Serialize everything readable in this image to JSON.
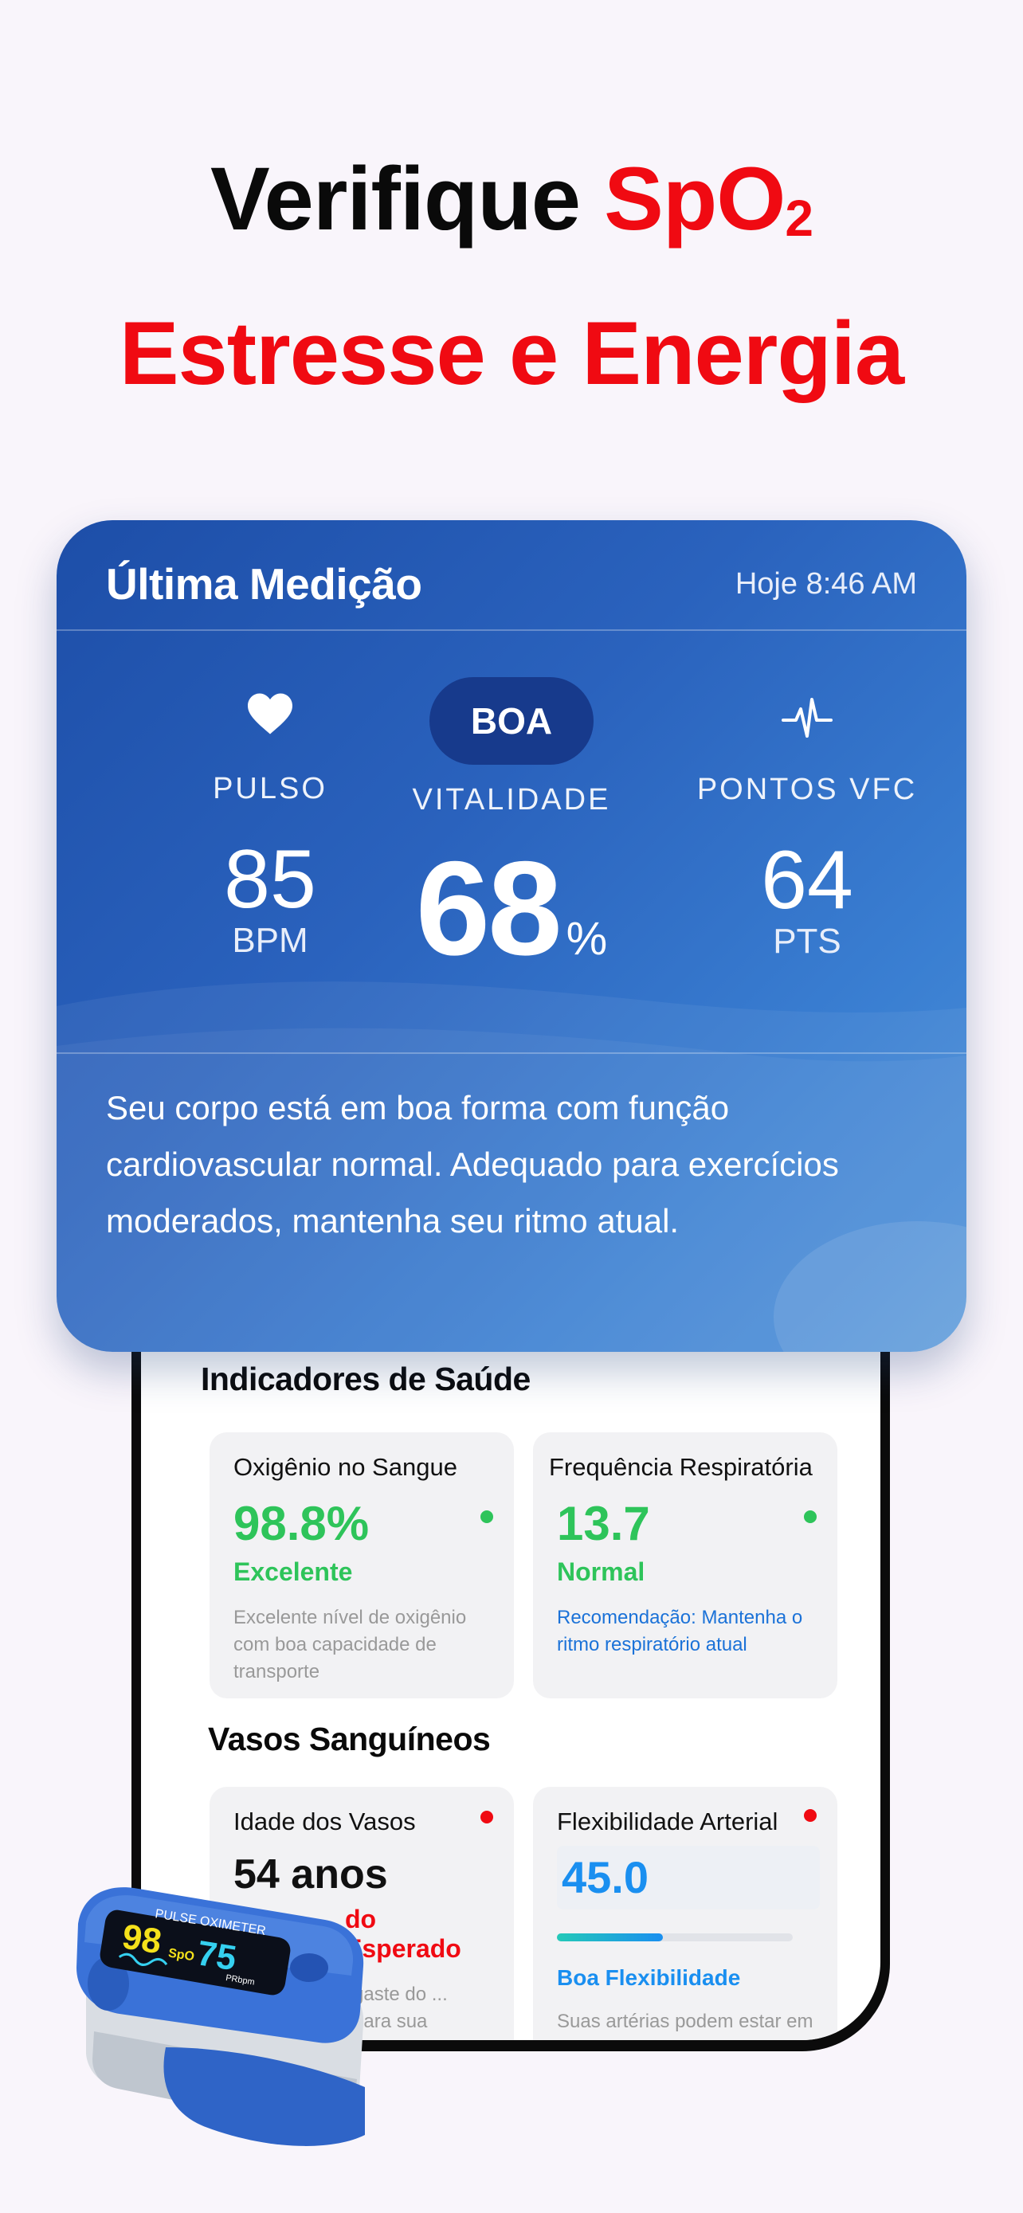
{
  "headline": {
    "line1_black": "Verifique",
    "line1_red": "SpO",
    "line1_sub": "2",
    "line2": "Estresse e Energia"
  },
  "card": {
    "title": "Última Medição",
    "time": "Hoje 8:46 AM",
    "pulse": {
      "label": "PULSO",
      "value": "85",
      "unit": "BPM",
      "icon": "heart-icon"
    },
    "vitality": {
      "badge": "BOA",
      "label": "VITALIDADE",
      "value": "68",
      "unit": "%"
    },
    "hrv": {
      "label": "PONTOS VFC",
      "value": "64",
      "unit": "PTS",
      "icon": "pulse-wave-icon"
    },
    "description": "Seu corpo está em boa forma com função cardiovascular normal. Adequado para exercícios moderados, mantenha seu ritmo atual."
  },
  "indicators": {
    "title": "Indicadores de Saúde",
    "oxygen": {
      "title": "Oxigênio no Sangue",
      "value": "98.8%",
      "status": "Excelente",
      "description": "Excelente nível de oxigênio com boa capacidade de transporte"
    },
    "respiration": {
      "title": "Frequência Respiratória",
      "value": "13.7",
      "status": "Normal",
      "description": "Recomendação: Mantenha o ritmo respiratório atual"
    }
  },
  "vessels": {
    "title": "Vasos Sanguíneos",
    "age": {
      "title": "Idade dos Vasos",
      "value": "54 anos",
      "status": "do Esperado",
      "description": "gaste do ... para sua"
    },
    "flexibility": {
      "title": "Flexibilidade Arterial",
      "value": "45.0",
      "level": 0.45,
      "status": "Boa Flexibilidade",
      "description": "Suas artérias podem estar em risco de AVC ou má"
    }
  },
  "device": {
    "brand": "PULSE OXIMETER",
    "spo2": "98",
    "spo2_label": "SpO",
    "pr": "75",
    "pr_label": "PRbpm"
  },
  "colors": {
    "accent_red": "#f00a12",
    "card_blue": "#2a62bd",
    "good_green": "#2ec45a",
    "info_blue": "#1a8ff0"
  }
}
